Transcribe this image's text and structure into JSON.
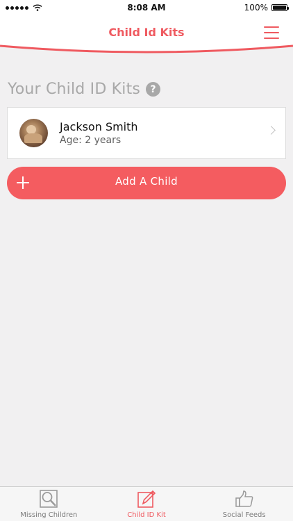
{
  "status_bar": {
    "time": "8:08 AM",
    "battery": "100%"
  },
  "header": {
    "title": "Child Id Kits"
  },
  "section": {
    "title": "Your Child ID Kits",
    "help": "?"
  },
  "children": [
    {
      "name": "Jackson Smith",
      "age": "Age: 2 years"
    }
  ],
  "add_button": {
    "label": "Add A Child"
  },
  "tabs": [
    {
      "label": "Missing Children",
      "icon": "magnifier-icon",
      "active": false
    },
    {
      "label": "Child ID Kit",
      "icon": "pencil-icon",
      "active": true
    },
    {
      "label": "Social Feeds",
      "icon": "thumbs-up-icon",
      "active": false
    }
  ],
  "colors": {
    "accent": "#ef5a60",
    "button": "#f45c60",
    "background": "#f1f0f1",
    "muted_text": "#a8a8a8"
  }
}
